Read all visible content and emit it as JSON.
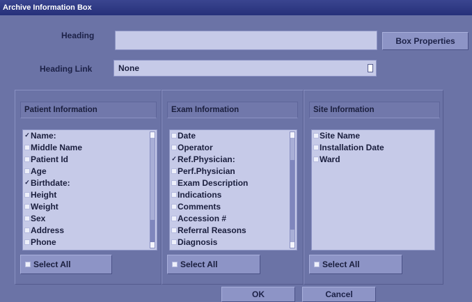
{
  "window": {
    "title": "Archive Information Box"
  },
  "heading": {
    "label": "Heading",
    "value": ""
  },
  "buttons": {
    "box_properties": "Box Properties",
    "ok": "OK",
    "cancel": "Cancel"
  },
  "heading_link": {
    "label": "Heading Link",
    "selected": "None"
  },
  "panels": {
    "patient": {
      "title": "Patient Information",
      "items": [
        {
          "label": "Name:",
          "checked": true
        },
        {
          "label": "Middle Name",
          "checked": false
        },
        {
          "label": "Patient Id",
          "checked": false
        },
        {
          "label": "Age",
          "checked": false
        },
        {
          "label": "Birthdate:",
          "checked": true
        },
        {
          "label": "Height",
          "checked": false
        },
        {
          "label": "Weight",
          "checked": false
        },
        {
          "label": "Sex",
          "checked": false
        },
        {
          "label": "Address",
          "checked": false
        },
        {
          "label": "Phone",
          "checked": false
        }
      ],
      "select_all": "Select All"
    },
    "exam": {
      "title": "Exam Information",
      "items": [
        {
          "label": "Date",
          "checked": false
        },
        {
          "label": "Operator",
          "checked": false
        },
        {
          "label": "Ref.Physician:",
          "checked": true
        },
        {
          "label": "Perf.Physician",
          "checked": false
        },
        {
          "label": "Exam Description",
          "checked": false
        },
        {
          "label": "Indications",
          "checked": false
        },
        {
          "label": "Comments",
          "checked": false
        },
        {
          "label": "Accession #",
          "checked": false
        },
        {
          "label": "Referral Reasons",
          "checked": false
        },
        {
          "label": "Diagnosis",
          "checked": false
        }
      ],
      "select_all": "Select All"
    },
    "site": {
      "title": "Site Information",
      "items": [
        {
          "label": "Site Name",
          "checked": false
        },
        {
          "label": "Installation Date",
          "checked": false
        },
        {
          "label": "Ward",
          "checked": false
        }
      ],
      "select_all": "Select All"
    }
  },
  "colors": {
    "background": "#6b73a6",
    "titlebar": "#26307a",
    "field": "#c6cae8"
  }
}
